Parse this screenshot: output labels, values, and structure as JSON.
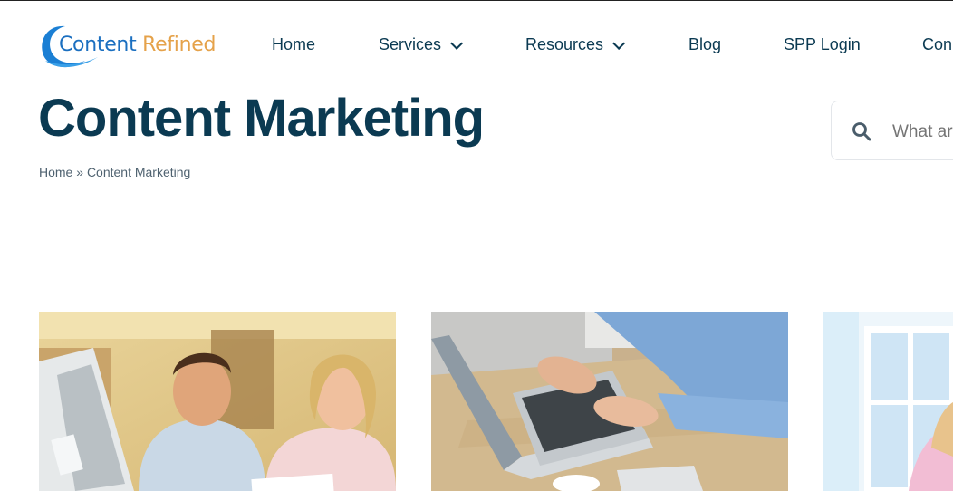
{
  "logo": {
    "word1": "Content",
    "word2": "Refined"
  },
  "nav": {
    "items": [
      {
        "label": "Home",
        "dropdown": false
      },
      {
        "label": "Services",
        "dropdown": true
      },
      {
        "label": "Resources",
        "dropdown": true
      },
      {
        "label": "Blog",
        "dropdown": false
      },
      {
        "label": "SPP Login",
        "dropdown": false
      },
      {
        "label": "Con",
        "dropdown": false
      }
    ]
  },
  "page": {
    "title": "Content Marketing"
  },
  "breadcrumb": {
    "home": "Home",
    "separator": "»",
    "current": "Content Marketing"
  },
  "search": {
    "placeholder": "What are you looking for?",
    "icon": "search-icon"
  },
  "cards": [
    {
      "image": "couple-at-computer-photo"
    },
    {
      "image": "hands-typing-laptop-photo"
    },
    {
      "image": "window-room-photo"
    }
  ],
  "colors": {
    "heading": "#0b3a52",
    "logo_blue": "#1b6fc0",
    "logo_orange": "#e5a24a"
  }
}
